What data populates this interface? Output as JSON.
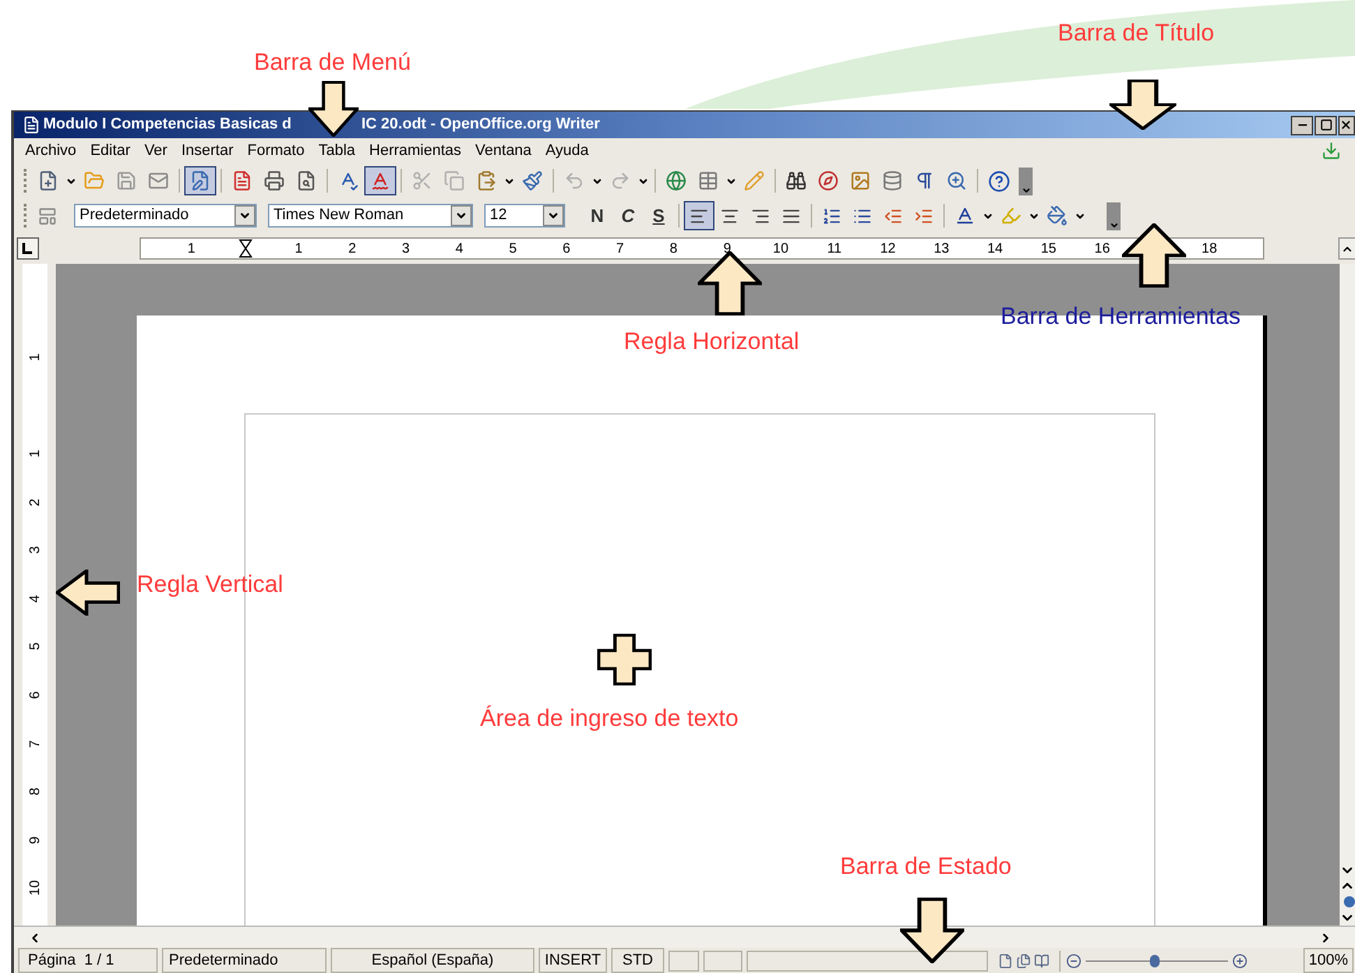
{
  "annotations": [
    {
      "kind": "title",
      "text": "Barra de Título",
      "color": "#ff3b3b"
    },
    {
      "kind": "menu",
      "text": "Barra de Menú",
      "color": "#ff3b3b"
    },
    {
      "kind": "toolbar",
      "text": "Barra de Herramientas",
      "color": "#1c1c9c"
    },
    {
      "kind": "hruler",
      "text": "Regla Horizontal",
      "color": "#ff3b3b"
    },
    {
      "kind": "vruler",
      "text": "Regla Vertical",
      "color": "#ff3b3b"
    },
    {
      "kind": "textarea",
      "text": "Área de ingreso de texto",
      "color": "#ff3b3b"
    },
    {
      "kind": "status",
      "text": "Barra de Estado",
      "color": "#ff3b3b"
    }
  ],
  "window": {
    "title_parts": [
      "Modulo I Competencias Basicas d",
      "IC 20.odt - OpenOffice.org Writer"
    ]
  },
  "menu": [
    "Archivo",
    "Editar",
    "Ver",
    "Insertar",
    "Formato",
    "Tabla",
    "Herramientas",
    "Ventana",
    "Ayuda"
  ],
  "toolbar_toggles": [
    {
      "selected": true
    },
    {
      "selected": true
    }
  ],
  "formatting": {
    "style": "Predeterminado",
    "font": "Times New Roman",
    "size": "12",
    "bold": "N",
    "italic": "C",
    "underline": "S",
    "alignment": [
      {
        "kind": "left",
        "selected": true
      },
      {
        "kind": "center",
        "selected": false
      },
      {
        "kind": "right",
        "selected": false
      },
      {
        "kind": "justify",
        "selected": false
      }
    ]
  },
  "ruler": {
    "horizontal": [
      "1",
      "1",
      "2",
      "3",
      "4",
      "5",
      "6",
      "7",
      "8",
      "9",
      "10",
      "11",
      "12",
      "13",
      "14",
      "15",
      "16",
      "18"
    ],
    "vertical": [
      "1",
      "1",
      "2",
      "3",
      "4",
      "5",
      "6",
      "7",
      "8",
      "9",
      "10"
    ]
  },
  "status_bar": {
    "page": "Página  1 / 1",
    "style": "Predeterminado",
    "language": "Español (España)",
    "insert_mode": "INSERT",
    "selection_mode": "STD",
    "zoom": {
      "level": 0.48
    },
    "zoom_percent": "100%"
  }
}
